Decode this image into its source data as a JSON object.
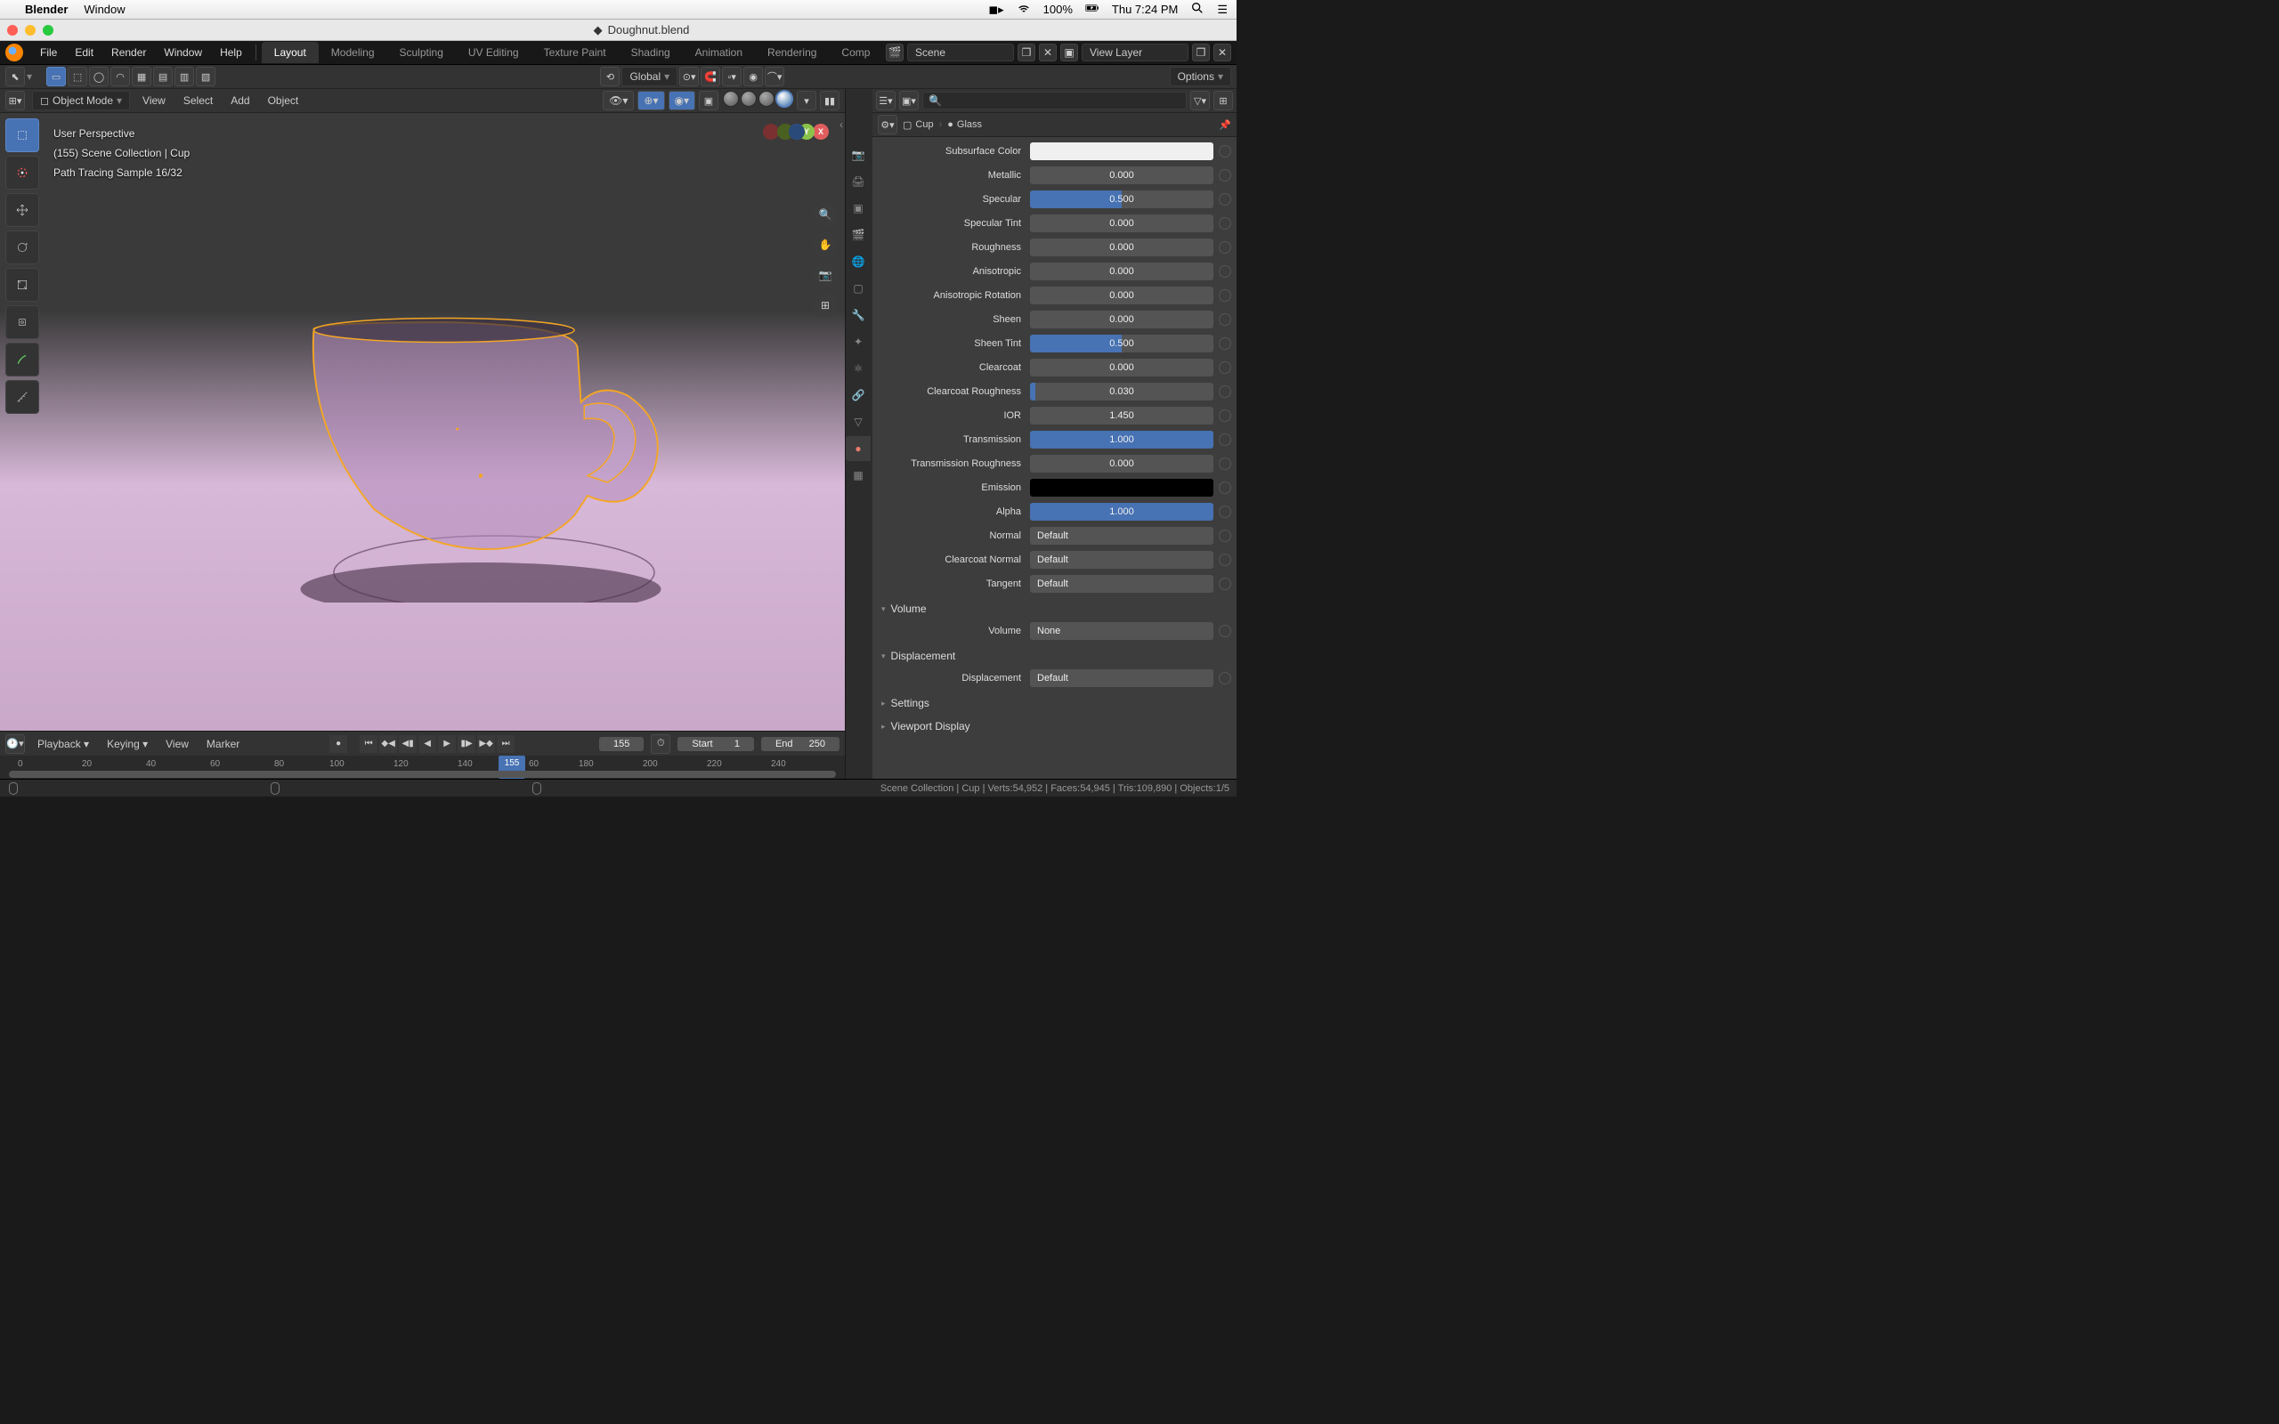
{
  "mac_menubar": {
    "app": "Blender",
    "menu": "Window",
    "battery": "100%",
    "clock": "Thu 7:24 PM"
  },
  "window": {
    "title": "Doughnut.blend"
  },
  "topbar": {
    "menus": [
      "File",
      "Edit",
      "Render",
      "Window",
      "Help"
    ],
    "workspaces": [
      "Layout",
      "Modeling",
      "Sculpting",
      "UV Editing",
      "Texture Paint",
      "Shading",
      "Animation",
      "Rendering",
      "Comp"
    ],
    "active_workspace": "Layout",
    "scene_label": "Scene",
    "viewlayer_label": "View Layer"
  },
  "tool_header": {
    "orientation": "Global",
    "options": "Options"
  },
  "viewport_header": {
    "mode": "Object Mode",
    "menus": [
      "View",
      "Select",
      "Add",
      "Object"
    ]
  },
  "viewport_overlay": {
    "line1": "User Perspective",
    "line2": "(155) Scene Collection | Cup",
    "line3": "Path Tracing Sample 16/32"
  },
  "timeline": {
    "menus": [
      "Playback",
      "Keying",
      "View",
      "Marker"
    ],
    "current_frame": "155",
    "start_label": "Start",
    "start": "1",
    "end_label": "End",
    "end": "250",
    "ticks": [
      "0",
      "20",
      "40",
      "60",
      "80",
      "100",
      "120",
      "140",
      "155",
      "60",
      "180",
      "200",
      "220",
      "240"
    ]
  },
  "props_breadcrumb": {
    "object": "Cup",
    "material": "Glass"
  },
  "material_props": [
    {
      "label": "Subsurface Color",
      "type": "color",
      "color": "#f0f0f0"
    },
    {
      "label": "Metallic",
      "value": "0.000",
      "fill": 0
    },
    {
      "label": "Specular",
      "value": "0.500",
      "fill": 50
    },
    {
      "label": "Specular Tint",
      "value": "0.000",
      "fill": 0
    },
    {
      "label": "Roughness",
      "value": "0.000",
      "fill": 0
    },
    {
      "label": "Anisotropic",
      "value": "0.000",
      "fill": 0
    },
    {
      "label": "Anisotropic Rotation",
      "value": "0.000",
      "fill": 0
    },
    {
      "label": "Sheen",
      "value": "0.000",
      "fill": 0
    },
    {
      "label": "Sheen Tint",
      "value": "0.500",
      "fill": 50
    },
    {
      "label": "Clearcoat",
      "value": "0.000",
      "fill": 0
    },
    {
      "label": "Clearcoat Roughness",
      "value": "0.030",
      "fill": 3
    },
    {
      "label": "IOR",
      "value": "1.450",
      "fill": 0,
      "nofill": true
    },
    {
      "label": "Transmission",
      "value": "1.000",
      "fill": 100
    },
    {
      "label": "Transmission Roughness",
      "value": "0.000",
      "fill": 0
    },
    {
      "label": "Emission",
      "type": "color",
      "color": "#000000"
    },
    {
      "label": "Alpha",
      "value": "1.000",
      "fill": 100
    },
    {
      "label": "Normal",
      "value": "Default",
      "type": "text"
    },
    {
      "label": "Clearcoat Normal",
      "value": "Default",
      "type": "text"
    },
    {
      "label": "Tangent",
      "value": "Default",
      "type": "text"
    }
  ],
  "panels": {
    "volume": "Volume",
    "volume_label": "Volume",
    "volume_value": "None",
    "displacement": "Displacement",
    "disp_label": "Displacement",
    "disp_value": "Default",
    "settings": "Settings",
    "viewport_display": "Viewport Display"
  },
  "statusbar": {
    "stats": "Scene Collection | Cup | Verts:54,952 | Faces:54,945 | Tris:109,890 | Objects:1/5"
  }
}
